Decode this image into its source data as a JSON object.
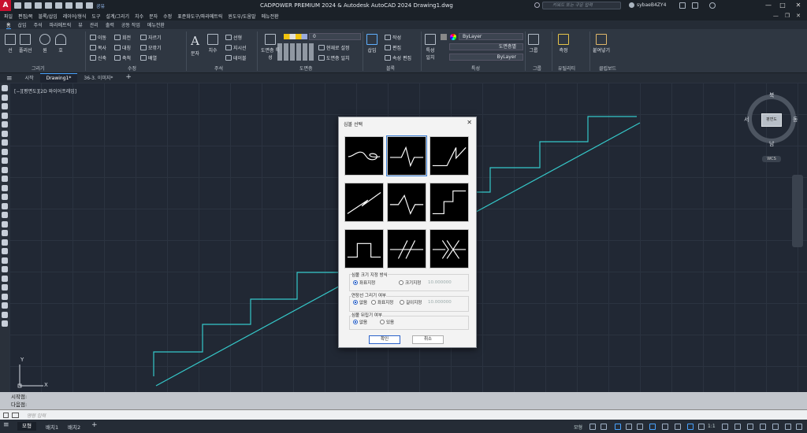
{
  "titlebar": {
    "app_logo": "A",
    "share_label": "공유",
    "title": "CADPOWER PREMIUM 2024  & Autodesk AutoCAD 2024    Drawing1.dwg",
    "search_placeholder": "키워드 또는 구문 입력",
    "user_name": "sybaeB4ZY4",
    "minimize": "—",
    "maximize": "□",
    "close": "✕"
  },
  "menubar": {
    "items": [
      "파일",
      "편집/복",
      "블록/삽입",
      "레이어/형식",
      "도구",
      "설계/그리기",
      "치수",
      "문자",
      "수정",
      "표준화도구/파라메트릭",
      "윈도우/도움말",
      "메뉴전환"
    ]
  },
  "ribbon_tabs": {
    "items": [
      "홈",
      "삽입",
      "주석",
      "파라메트릭",
      "뷰",
      "관리",
      "출력",
      "공동 작업",
      "메뉴전환"
    ],
    "active": 0
  },
  "ribbon": {
    "draw": {
      "title": "그리기",
      "line": "선",
      "polyline": "폴리선",
      "circle": "원",
      "arc": "호"
    },
    "modify": {
      "title": "수정",
      "move": "이동",
      "rotate": "회전",
      "trim": "자르기",
      "copy": "복사",
      "mirror": "대칭",
      "fillet": "모깎기",
      "stretch": "신축",
      "scale": "축척",
      "array": "배열"
    },
    "annotation": {
      "title": "주석",
      "text": "문자",
      "dimension": "치수",
      "leader": "선형",
      "multileader": "지시선",
      "table": "테이블"
    },
    "layers": {
      "title": "도면층",
      "properties": "도면층 특성",
      "current_layer": "0",
      "make_current": "현재로 설정",
      "match_layer": "도면층 일치"
    },
    "block": {
      "title": "블록",
      "insert": "삽입",
      "create": "작성",
      "edit": "편집",
      "edit_attributes": "속성 편집"
    },
    "properties": {
      "title": "특성",
      "match": "특성 일치",
      "color": "ByLayer",
      "linetype": "도면층별",
      "lineweight": "ByLayer"
    },
    "groups": {
      "title": "그룹",
      "group": "그룹"
    },
    "utilities": {
      "title": "유틸리티",
      "measure": "측정"
    },
    "clipboard": {
      "title": "클립보드",
      "paste": "붙여넣기"
    }
  },
  "filetabs": {
    "items": [
      "시작",
      "Drawing1*",
      "36-3. 이미지*"
    ],
    "active": 1,
    "new_tab": "+"
  },
  "viewport": {
    "label": "[−][평면도][2D 와이어프레임]"
  },
  "viewcube": {
    "north": "북",
    "south": "남",
    "east": "동",
    "west": "서",
    "face": "평면도",
    "wcs": "WCS"
  },
  "ucs": {
    "x": "X",
    "y": "Y"
  },
  "dialog": {
    "title": "심볼 선택",
    "close": "✕",
    "symbols": [
      "wave-break",
      "zigzag-break",
      "z-break",
      "double-slash-break",
      "n-zigzag-break",
      "step-up-break",
      "notch-break",
      "double-slash-gap",
      "arrow-gap"
    ],
    "selected_index": 1,
    "size_group": {
      "label": "심볼 크기 지정 방식",
      "opt_auto": "좌표지정",
      "opt_size": "크기지정",
      "value": "10.000000",
      "selected": "auto"
    },
    "extension_group": {
      "label": "연장선 그리기 여부",
      "opt_none": "없음",
      "opt_coord": "좌표지정",
      "opt_length": "길이지정",
      "value": "10.000000",
      "selected": "none"
    },
    "flip_group": {
      "label": "심볼 뒤집기 여부",
      "opt_none": "없음",
      "opt_yes": "있음",
      "selected": "none"
    },
    "ok": "확인",
    "cancel": "취소"
  },
  "command": {
    "history": [
      "시작점:",
      "다음점:"
    ],
    "prompt": "명령 입력"
  },
  "statusbar": {
    "layout_tabs": [
      "모형",
      "배치1",
      "배치2"
    ],
    "active_layout": 0,
    "new_layout": "+",
    "model_label": "모형",
    "scale": "1:1"
  },
  "colors": {
    "staircase_line": "#35c8c9",
    "accent": "#4aa3ff"
  }
}
